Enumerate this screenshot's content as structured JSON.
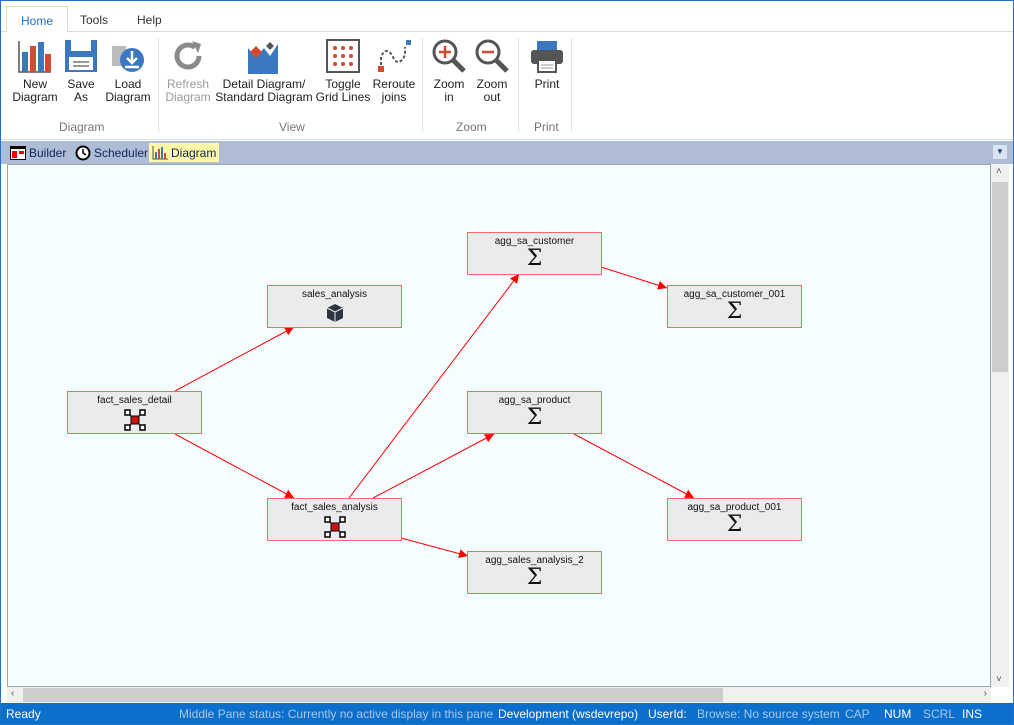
{
  "menu_tabs": [
    {
      "label": "Home",
      "active": true
    },
    {
      "label": "Tools"
    },
    {
      "label": "Help"
    }
  ],
  "ribbon": {
    "groups": {
      "diagram": "Diagram",
      "view": "View",
      "zoom": "Zoom",
      "print": "Print"
    },
    "buttons": {
      "new_diagram": [
        "New",
        "Diagram"
      ],
      "save_as": [
        "Save",
        "As"
      ],
      "load_diagram": [
        "Load",
        "Diagram"
      ],
      "refresh_diagram": [
        "Refresh",
        "Diagram"
      ],
      "detail_standard": [
        "Detail Diagram/",
        "Standard Diagram"
      ],
      "toggle_grid": [
        "Toggle",
        "Grid Lines"
      ],
      "reroute_joins": [
        "Reroute",
        "joins"
      ],
      "zoom_in": [
        "Zoom",
        "in"
      ],
      "zoom_out": [
        "Zoom",
        "out"
      ],
      "print": [
        "Print"
      ]
    }
  },
  "doc_tabs": [
    {
      "label": "Builder"
    },
    {
      "label": "Scheduler"
    },
    {
      "label": "Diagram",
      "active": true
    }
  ],
  "nodes": [
    {
      "name": "agg_sa_customer",
      "icon": "sigma-icon"
    },
    {
      "name": "agg_sa_customer_001",
      "icon": "sigma-icon"
    },
    {
      "name": "sales_analysis",
      "icon": "cube-icon"
    },
    {
      "name": "fact_sales_detail",
      "icon": "fact-table-icon"
    },
    {
      "name": "agg_sa_product",
      "icon": "sigma-icon"
    },
    {
      "name": "fact_sales_analysis",
      "icon": "fact-table-icon"
    },
    {
      "name": "agg_sa_product_001",
      "icon": "sigma-icon"
    },
    {
      "name": "agg_sales_analysis_2",
      "icon": "sigma-icon"
    }
  ],
  "sigma": "Σ",
  "colors": {
    "accent": "#1e6fc0",
    "status_bar": "#0b6fcb",
    "edge": "#ff0000",
    "node_border": "#f26b6b"
  },
  "status": {
    "ready": "Ready",
    "middle_pane": "Middle Pane status: Currently no active display in this pane",
    "environment": "Development (wsdevrepo)",
    "userid": "UserId:",
    "browse": "Browse: No source system",
    "cap": "CAP",
    "num": "NUM",
    "scrl": "SCRL",
    "ins": "INS"
  }
}
